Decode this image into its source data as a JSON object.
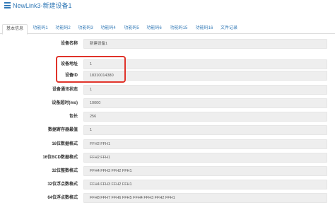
{
  "header": {
    "title": "NewLink3-新建设备1",
    "icon": "list-icon",
    "accent_color": "#337ab7"
  },
  "tabs": [
    {
      "label": "基本信息",
      "active": true
    },
    {
      "label": "功能码1",
      "active": false
    },
    {
      "label": "功能码2",
      "active": false
    },
    {
      "label": "功能码3",
      "active": false
    },
    {
      "label": "功能码4",
      "active": false
    },
    {
      "label": "功能码5",
      "active": false
    },
    {
      "label": "功能码6",
      "active": false
    },
    {
      "label": "功能码15",
      "active": false
    },
    {
      "label": "功能码16",
      "active": false
    },
    {
      "label": "文件记录",
      "active": false
    }
  ],
  "fields": [
    {
      "label": "设备名称",
      "value": "新建设备1"
    },
    {
      "label": "设备地址",
      "value": "1"
    },
    {
      "label": "设备ID",
      "value": "18310014380"
    },
    {
      "label": "设备通讯状态",
      "value": "1"
    },
    {
      "label": "设备超时(ms)",
      "value": "10000"
    },
    {
      "label": "包长",
      "value": "256"
    },
    {
      "label": "数据寄存器最值",
      "value": "1"
    },
    {
      "label": "16位数据格式",
      "value": "FFH2 FFH1"
    },
    {
      "label": "16位BCD数据格式",
      "value": "FFH2 FFH1"
    },
    {
      "label": "32位整数格式",
      "value": "FFH4 FFH3 FFH2 FFH1"
    },
    {
      "label": "32位浮点数格式",
      "value": "FFH4 FFH3 FFH2 FFH1"
    },
    {
      "label": "64位浮点数格式",
      "value": "FFH8 FFH7 FFH6 FFH5 FFH4 FFH3 FFH2 FFH1"
    }
  ],
  "highlight_color": "#e0332a"
}
